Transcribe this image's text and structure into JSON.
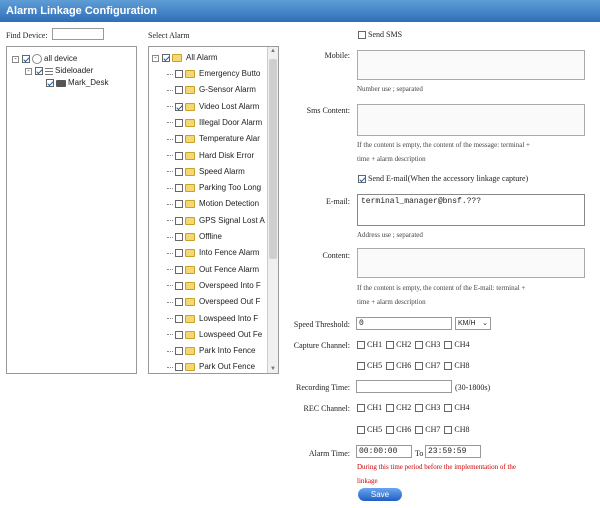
{
  "window": {
    "title": "Alarm Linkage Configuration"
  },
  "device_panel": {
    "find_label": "Find Device:",
    "find_value": "",
    "tree": [
      {
        "label": "all device",
        "checked": true,
        "icon": "gear-icon"
      },
      {
        "label": "Sideloader",
        "checked": true,
        "icon": "grid-icon"
      },
      {
        "label": "Mark_Desk",
        "checked": true,
        "icon": "vehicle-icon"
      }
    ]
  },
  "alarm_panel": {
    "label": "Select Alarm",
    "root": "All Alarm",
    "items": [
      {
        "label": "Emergency Butto",
        "checked": false
      },
      {
        "label": "G-Sensor Alarm",
        "checked": false
      },
      {
        "label": "Video Lost Alarm",
        "checked": true
      },
      {
        "label": "Illegal Door Alarm",
        "checked": false
      },
      {
        "label": "Temperature Alar",
        "checked": false
      },
      {
        "label": "Hard Disk Error",
        "checked": false
      },
      {
        "label": "Speed Alarm",
        "checked": false
      },
      {
        "label": "Parking Too Long",
        "checked": false
      },
      {
        "label": "Motion Detection",
        "checked": false
      },
      {
        "label": "GPS Signal Lost A",
        "checked": false
      },
      {
        "label": "Offline",
        "checked": false
      },
      {
        "label": "Into Fence Alarm",
        "checked": false
      },
      {
        "label": "Out Fence Alarm",
        "checked": false
      },
      {
        "label": "Overspeed Into F",
        "checked": false
      },
      {
        "label": "Overspeed Out F",
        "checked": false
      },
      {
        "label": "Lowspeed Into F",
        "checked": false
      },
      {
        "label": "Lowspeed Out Fe",
        "checked": false
      },
      {
        "label": "Park Into Fence",
        "checked": false
      },
      {
        "label": "Park Out Fence",
        "checked": false
      }
    ]
  },
  "form": {
    "send_sms": "Send SMS",
    "mobile_label": "Mobile:",
    "mobile_hint": "Number use ; separated",
    "sms_label": "Sms Content:",
    "sms_hint_1": "If the content is empty, the content of the message: terminal +",
    "sms_hint_2": "time + alarm description",
    "send_email": "Send E-mail(When the accessory linkage capture)",
    "email_label": "E-mail:",
    "email_value": "terminal_manager@bnsf.???",
    "email_hint": "Address use ; separated",
    "content_label": "Content:",
    "content_hint_1": "If the content is empty, the content of the E-mail: terminal +",
    "content_hint_2": "time + alarm description",
    "speed_label": "Speed Threshold:",
    "speed_value": "0",
    "speed_unit": "KM/H",
    "capture_label": "Capture Channel:",
    "recording_label": "Recording Time:",
    "recording_value": "",
    "recording_hint": "(30-1800s)",
    "rec_label": "REC Channel:",
    "alarm_time_label": "Alarm Time:",
    "time_from": "00:00:00",
    "time_to_label": "To",
    "time_to": "23:59:59",
    "warning_1": "During this time period before the implementation of the",
    "warning_2": "linkage",
    "save_label": "Save"
  },
  "channels_row1": [
    "CH1",
    "CH2",
    "CH3",
    "CH4"
  ],
  "channels_row2": [
    "CH5",
    "CH6",
    "CH7",
    "CH8"
  ],
  "colors": {
    "title_bar": "#2f6fb8",
    "warning": "#cc0000",
    "folder": "#f5d774"
  }
}
